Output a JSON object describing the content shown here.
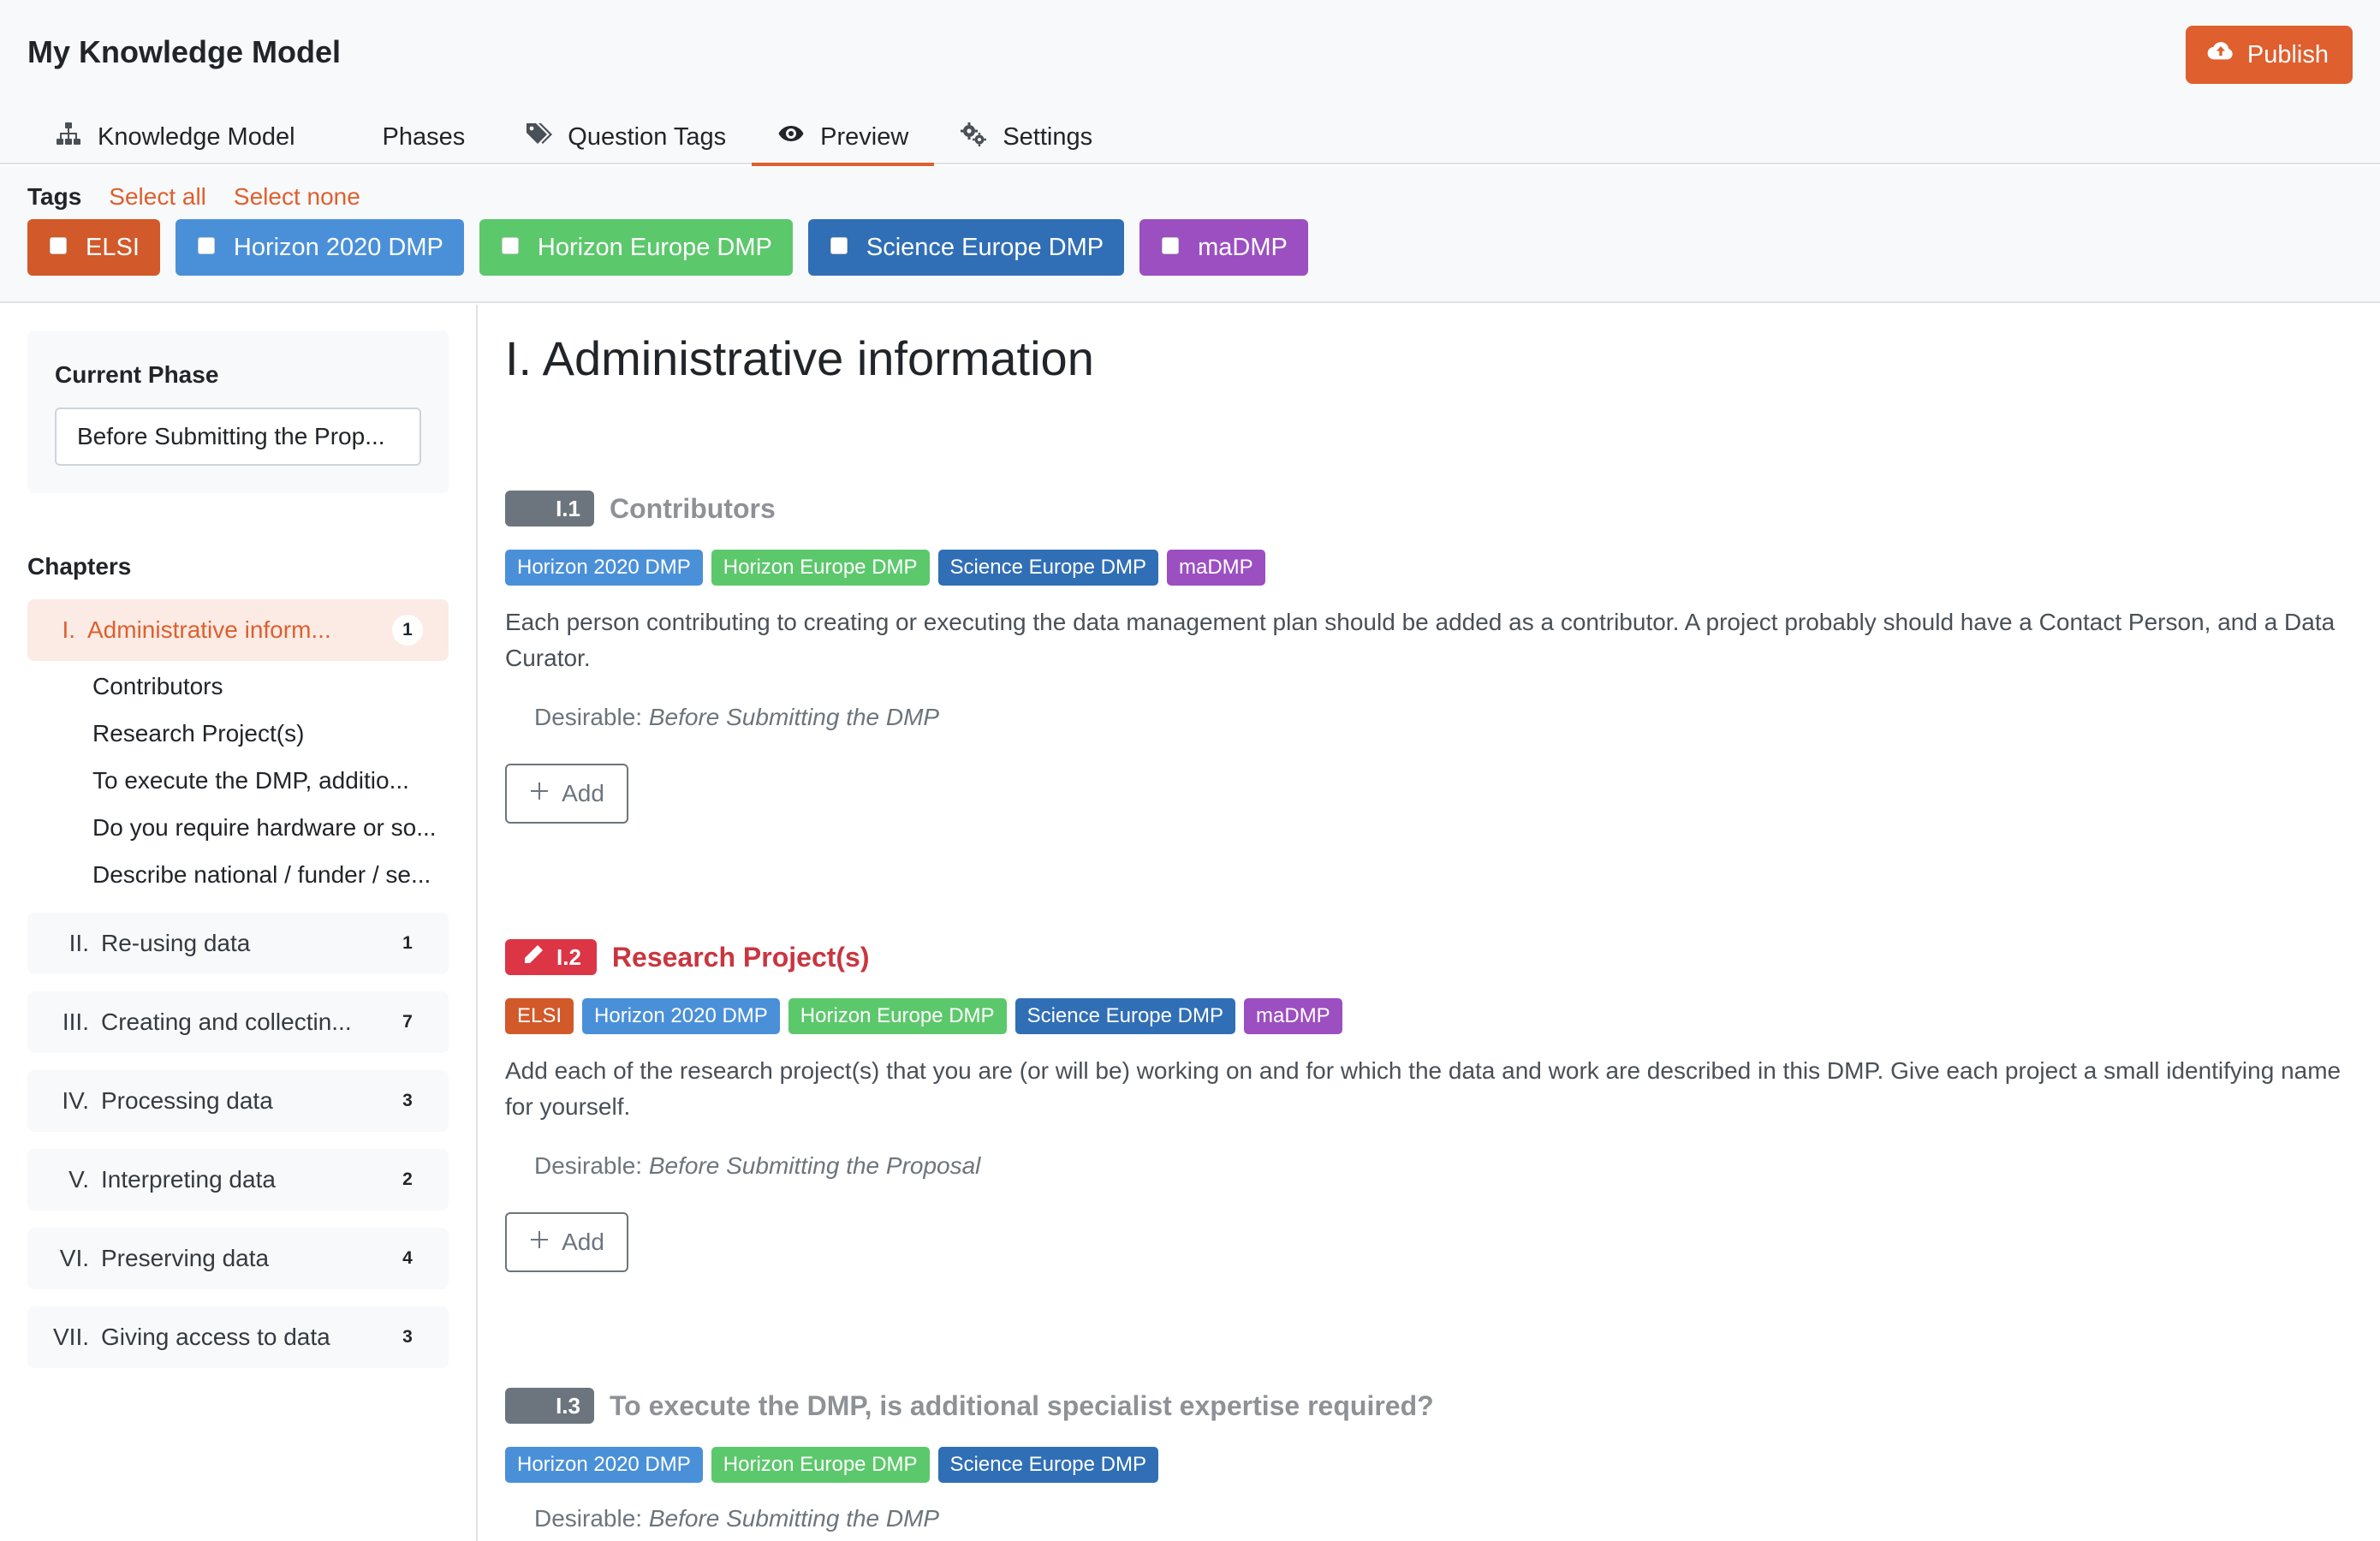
{
  "app": {
    "title": "My Knowledge Model",
    "publish_label": "Publish"
  },
  "tabs": [
    {
      "label": "Knowledge Model",
      "icon": "sitemap-icon",
      "active": false
    },
    {
      "label": "Phases",
      "icon": "",
      "active": false
    },
    {
      "label": "Question Tags",
      "icon": "tags-icon",
      "active": false
    },
    {
      "label": "Preview",
      "icon": "eye-icon",
      "active": true
    },
    {
      "label": "Settings",
      "icon": "cogs-icon",
      "active": false
    }
  ],
  "tags_bar": {
    "label": "Tags",
    "select_all": "Select all",
    "select_none": "Select none",
    "tags": [
      {
        "label": "ELSI",
        "color": "#d2592a",
        "checked": false
      },
      {
        "label": "Horizon 2020 DMP",
        "color": "#4a90d9",
        "checked": false
      },
      {
        "label": "Horizon Europe DMP",
        "color": "#5cc86c",
        "checked": false
      },
      {
        "label": "Science Europe DMP",
        "color": "#306fb5",
        "checked": false
      },
      {
        "label": "maDMP",
        "color": "#9b4fc1",
        "checked": false
      }
    ]
  },
  "sidebar": {
    "phase_title": "Current Phase",
    "phase_value": "Before Submitting the Prop...",
    "chapters_title": "Chapters",
    "chapters": [
      {
        "num": "I.",
        "name": "Administrative inform...",
        "count": "1",
        "active": true
      },
      {
        "num": "II.",
        "name": "Re-using data",
        "count": "1",
        "active": false
      },
      {
        "num": "III.",
        "name": "Creating and collectin...",
        "count": "7",
        "active": false
      },
      {
        "num": "IV.",
        "name": "Processing data",
        "count": "3",
        "active": false
      },
      {
        "num": "V.",
        "name": "Interpreting data",
        "count": "2",
        "active": false
      },
      {
        "num": "VI.",
        "name": "Preserving data",
        "count": "4",
        "active": false
      },
      {
        "num": "VII.",
        "name": "Giving access to data",
        "count": "3",
        "active": false
      }
    ],
    "subitems": [
      "Contributors",
      "Research Project(s)",
      "To execute the DMP, additio...",
      "Do you require hardware or so...",
      "Describe national / funder / se..."
    ]
  },
  "main": {
    "chapter_title": "I. Administrative information",
    "desirable_label": "Desirable:",
    "add_label": "Add",
    "questions": [
      {
        "number": "I.1",
        "title": "Contributors",
        "style": "grey",
        "tags": [
          "Horizon 2020 DMP",
          "Horizon Europe DMP",
          "Science Europe DMP",
          "maDMP"
        ],
        "description": "Each person contributing to creating or executing the data management plan should be added as a contributor. A project probably should have a Contact Person, and a Data Curator.",
        "desirable": "Before Submitting the DMP"
      },
      {
        "number": "I.2",
        "title": "Research Project(s)",
        "style": "red",
        "tags": [
          "ELSI",
          "Horizon 2020 DMP",
          "Horizon Europe DMP",
          "Science Europe DMP",
          "maDMP"
        ],
        "description": "Add each of the research project(s) that you are (or will be) working on and for which the data and work are described in this DMP. Give each project a small identifying name for yourself.",
        "desirable": "Before Submitting the Proposal"
      },
      {
        "number": "I.3",
        "title": "To execute the DMP, is additional specialist expertise required?",
        "style": "grey",
        "tags": [
          "Horizon 2020 DMP",
          "Horizon Europe DMP",
          "Science Europe DMP"
        ],
        "description": "",
        "desirable": "Before Submitting the DMP"
      }
    ]
  },
  "tag_colors": {
    "ELSI": "#d2592a",
    "Horizon 2020 DMP": "#4a90d9",
    "Horizon Europe DMP": "#5cc86c",
    "Science Europe DMP": "#306fb5",
    "maDMP": "#9b4fc1"
  }
}
